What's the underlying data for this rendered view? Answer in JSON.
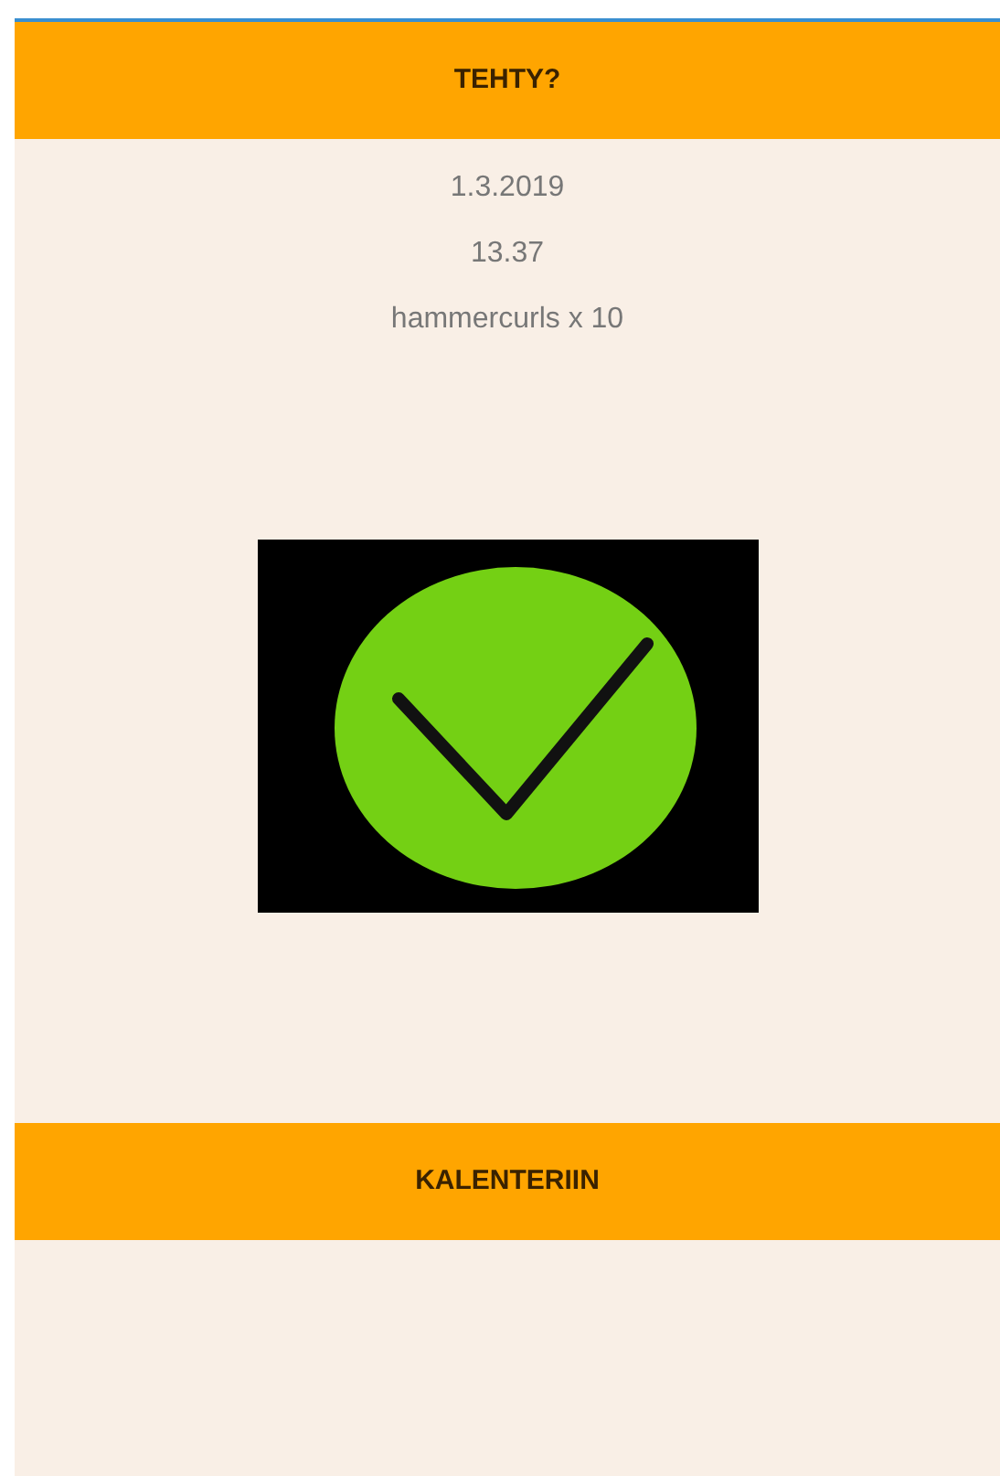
{
  "top_button": {
    "label": "TEHTY?"
  },
  "details": [
    "1.3.2019",
    "13.37",
    "hammercurls x 10"
  ],
  "done": true,
  "bottom_button": {
    "label": "KALENTERIIN"
  }
}
